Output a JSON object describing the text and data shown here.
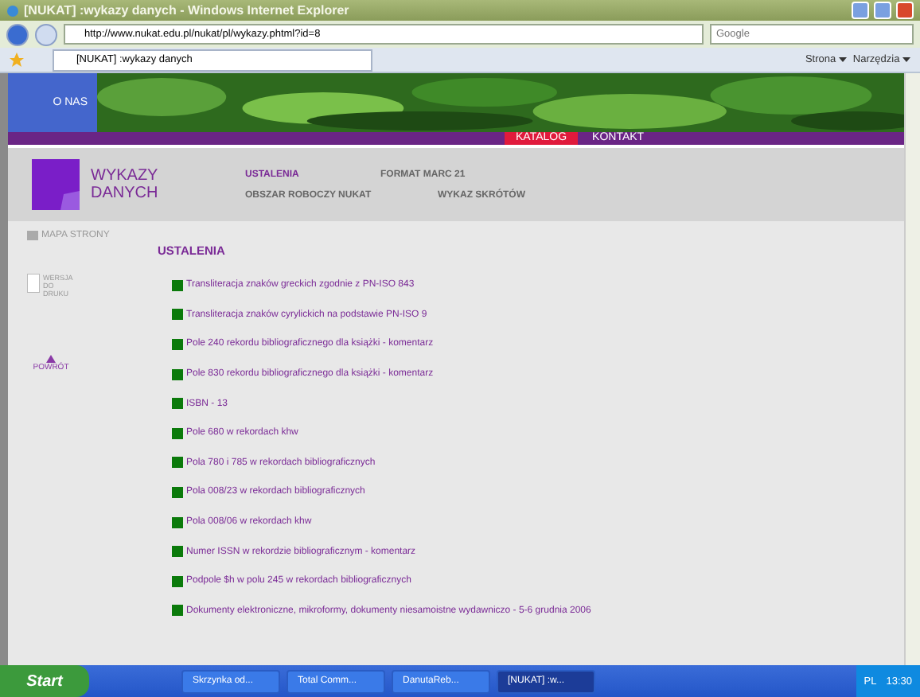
{
  "window": {
    "title": "[NUKAT] :wykazy danych - Windows Internet Explorer"
  },
  "address_bar": {
    "url": "http://www.nukat.edu.pl/nukat/pl/wykazy.phtml?id=8",
    "search_placeholder": "Google"
  },
  "browser_tabs": [
    {
      "label": "[NUKAT] :wykazy danych",
      "selected": true
    }
  ],
  "command_bar": [
    "Strona",
    "Narzędzia"
  ],
  "page": {
    "top_link": "O NAS",
    "top_menu": [
      {
        "label": "KATALOG",
        "selected": true
      },
      {
        "label": "KONTAKT",
        "selected": false
      }
    ],
    "logo": [
      "WYKAZY",
      "DANYCH"
    ],
    "nav": [
      {
        "label": "USTALENIA",
        "selected": true
      },
      {
        "label": "FORMAT MARC 21",
        "selected": false
      },
      {
        "label": "OBSZAR ROBOCZY NUKAT",
        "selected": false
      },
      {
        "label": "WYKAZ SKRÓTÓW",
        "selected": false
      }
    ],
    "site_map": "MAPA STRONY",
    "print_version": [
      "WERSJA",
      "DO",
      "DRUKU"
    ],
    "back": "POWRÓT",
    "heading": "USTALENIA",
    "items": [
      "Transliteracja znaków greckich zgodnie z PN-ISO 843",
      "Transliteracja znaków cyrylickich na podstawie PN-ISO 9",
      "Pole 240 rekordu bibliograficznego dla książki - komentarz",
      "Pole 830 rekordu bibliograficznego dla książki - komentarz",
      "ISBN - 13",
      "Pole 680 w rekordach khw",
      "Pola 780 i 785 w rekordach bibliograficznych",
      "Pola 008/23 w rekordach bibliograficznych",
      "Pola 008/06 w rekordach khw",
      "Numer ISSN w rekordzie bibliograficznym - komentarz",
      "Podpole $h w polu 245 w rekordach bibliograficznych",
      "Dokumenty elektroniczne, mikroformy, dokumenty niesamoistne wydawniczo - 5-6 grudnia 2006"
    ]
  },
  "taskbar": {
    "start": "Start",
    "tasks": [
      {
        "label": "Skrzynka od...",
        "selected": false
      },
      {
        "label": "Total Comm...",
        "selected": false
      },
      {
        "label": "DanutaReb...",
        "selected": false
      },
      {
        "label": "[NUKAT] :w...",
        "selected": true
      }
    ],
    "language": "PL",
    "clock": "13:30"
  }
}
